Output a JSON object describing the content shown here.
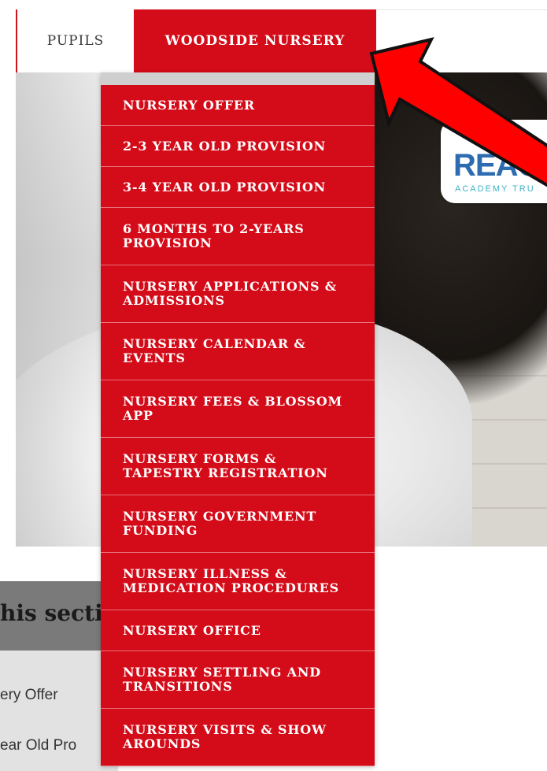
{
  "nav": {
    "tabs": [
      {
        "label": "PUPILS"
      },
      {
        "label": "WOODSIDE NURSERY"
      }
    ]
  },
  "logo": {
    "text": "REAC",
    "subtext": "ACADEMY TRU"
  },
  "dropdown": {
    "items": [
      {
        "label": "NURSERY OFFER"
      },
      {
        "label": "2-3 YEAR OLD PROVISION"
      },
      {
        "label": "3-4 YEAR OLD PROVISION"
      },
      {
        "label": "6 MONTHS TO 2-YEARS PROVISION"
      },
      {
        "label": "NURSERY APPLICATIONS & ADMISSIONS"
      },
      {
        "label": "NURSERY CALENDAR & EVENTS"
      },
      {
        "label": "NURSERY FEES & BLOSSOM APP"
      },
      {
        "label": "NURSERY FORMS & TAPESTRY REGISTRATION"
      },
      {
        "label": "NURSERY GOVERNMENT FUNDING"
      },
      {
        "label": "NURSERY ILLNESS & MEDICATION PROCEDURES"
      },
      {
        "label": "NURSERY OFFICE"
      },
      {
        "label": "NURSERY SETTLING AND TRANSITIONS"
      },
      {
        "label": "NURSERY VISITS & SHOW AROUNDS"
      }
    ]
  },
  "section": {
    "title": "his secti",
    "links": [
      "ery Offer",
      "ear Old Pro"
    ]
  },
  "colors": {
    "accent": "#d40b18",
    "arrow": "#ff0000"
  }
}
